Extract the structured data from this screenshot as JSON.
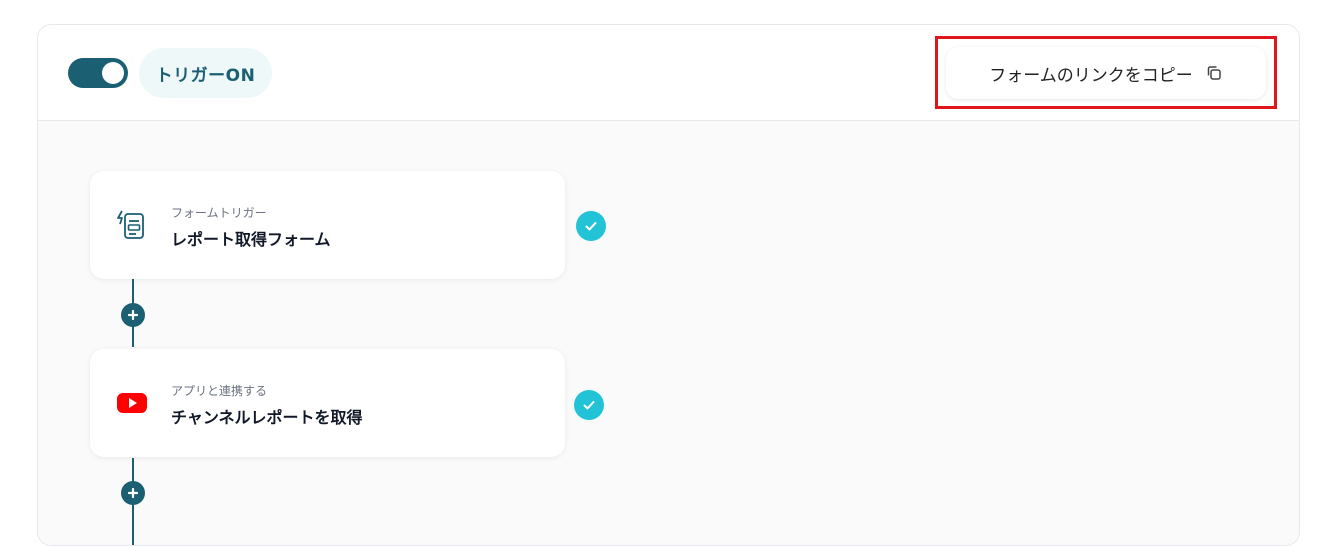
{
  "header": {
    "trigger_label": "トリガーON",
    "copy_link_label": "フォームのリンクをコピー",
    "toggle_state": "on"
  },
  "steps": [
    {
      "category": "フォームトリガー",
      "title": "レポート取得フォーム",
      "icon": "form-trigger-icon",
      "status": "complete"
    },
    {
      "category": "アプリと連携する",
      "title": "チャンネルレポートを取得",
      "icon": "youtube-icon",
      "status": "complete"
    }
  ],
  "colors": {
    "accent": "#1b5f73",
    "check": "#22c3d6",
    "highlight": "#e1161c",
    "youtube": "#ff0000"
  }
}
